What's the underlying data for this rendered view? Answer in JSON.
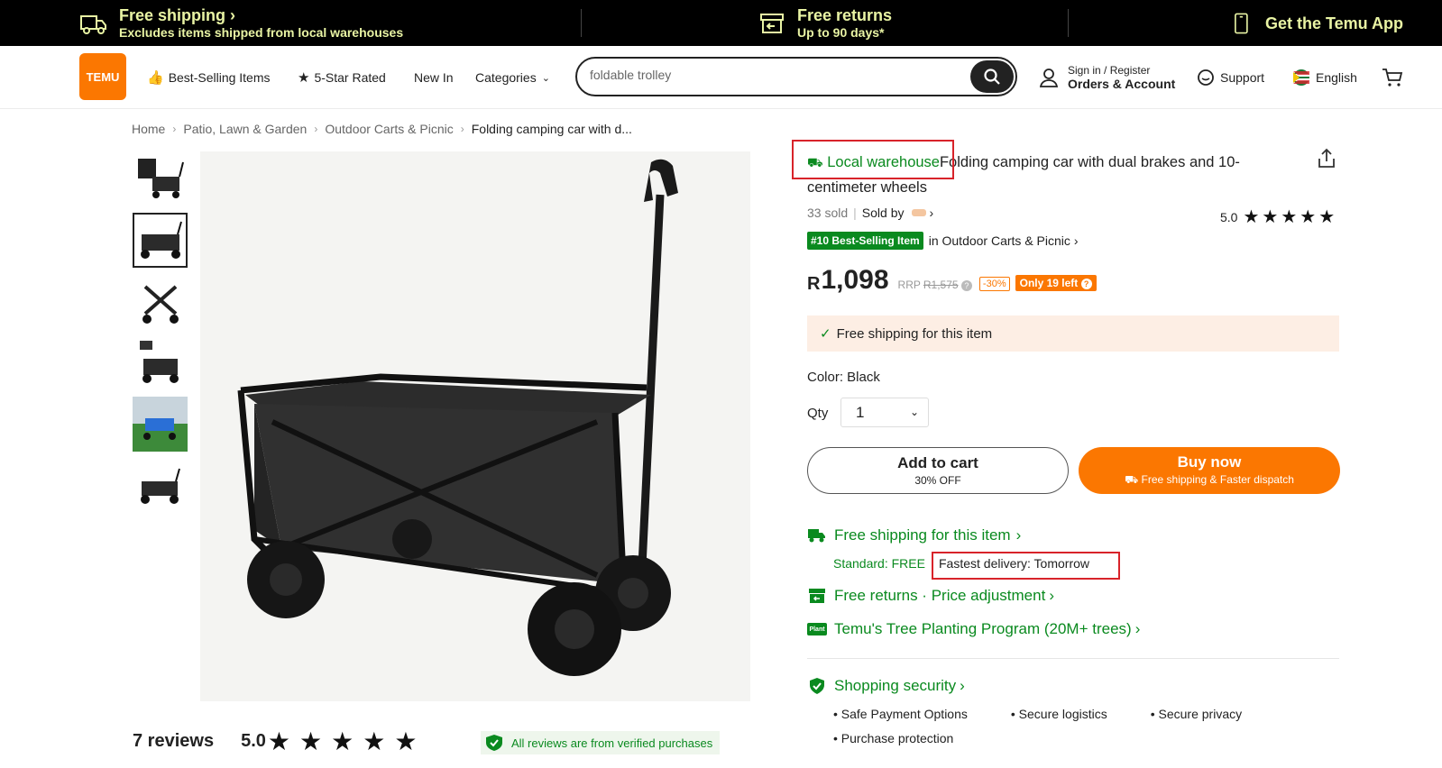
{
  "promo": {
    "shipping_title": "Free shipping",
    "shipping_sub": "Excludes items shipped from local warehouses",
    "returns_title": "Free returns",
    "returns_sub": "Up to 90 days*",
    "app": "Get the Temu App"
  },
  "header": {
    "logo_line1": "⚑⚑⚑",
    "logo_line2": "TEMU",
    "nav": [
      "Best-Selling Items",
      "5-Star Rated",
      "New In",
      "Categories"
    ],
    "search_value": "foldable trolley",
    "account_small": "Sign in / Register",
    "account_strong": "Orders & Account",
    "support": "Support",
    "language": "English"
  },
  "breadcrumb": [
    "Home",
    "Patio, Lawn & Garden",
    "Outdoor Carts & Picnic",
    "Folding camping car with d..."
  ],
  "product": {
    "local_warehouse": "Local warehouse",
    "title": "Folding camping car with dual brakes and 10-centimeter wheels",
    "sold": "33 sold",
    "sold_by": "Sold by",
    "rating": "5.0",
    "best_badge": "#10 Best-Selling Item",
    "best_in": "in Outdoor Carts & Picnic",
    "currency": "R",
    "price": "1,098",
    "rrp_label": "RRP",
    "rrp": "R1,575",
    "discount": "-30%",
    "stock": "Only 19 left",
    "ship_box": "Free shipping for this item",
    "color": "Color: Black",
    "qty_label": "Qty",
    "qty": "1",
    "add_to_cart": "Add to cart",
    "add_to_cart_sub": "30% OFF",
    "buy_now": "Buy now",
    "buy_now_sub": "Free shipping & Faster dispatch",
    "free_shipping_line": "Free shipping for this item",
    "standard": "Standard: FREE",
    "fastest": "Fastest delivery: Tomorrow",
    "free_returns": "Free returns · Price adjustment",
    "tree": "Temu's Tree Planting Program (20M+ trees)",
    "plant_tag": "Plant",
    "security": "Shopping security",
    "security_items": [
      "Safe Payment Options",
      "Secure logistics",
      "Secure privacy",
      "Purchase protection"
    ]
  },
  "reviews": {
    "count": "7 reviews",
    "score": "5.0",
    "verified": "All reviews are from verified purchases"
  },
  "colors": {
    "accent": "#fb7701",
    "green": "#0a8a1f",
    "highlight": "#d8232a"
  }
}
